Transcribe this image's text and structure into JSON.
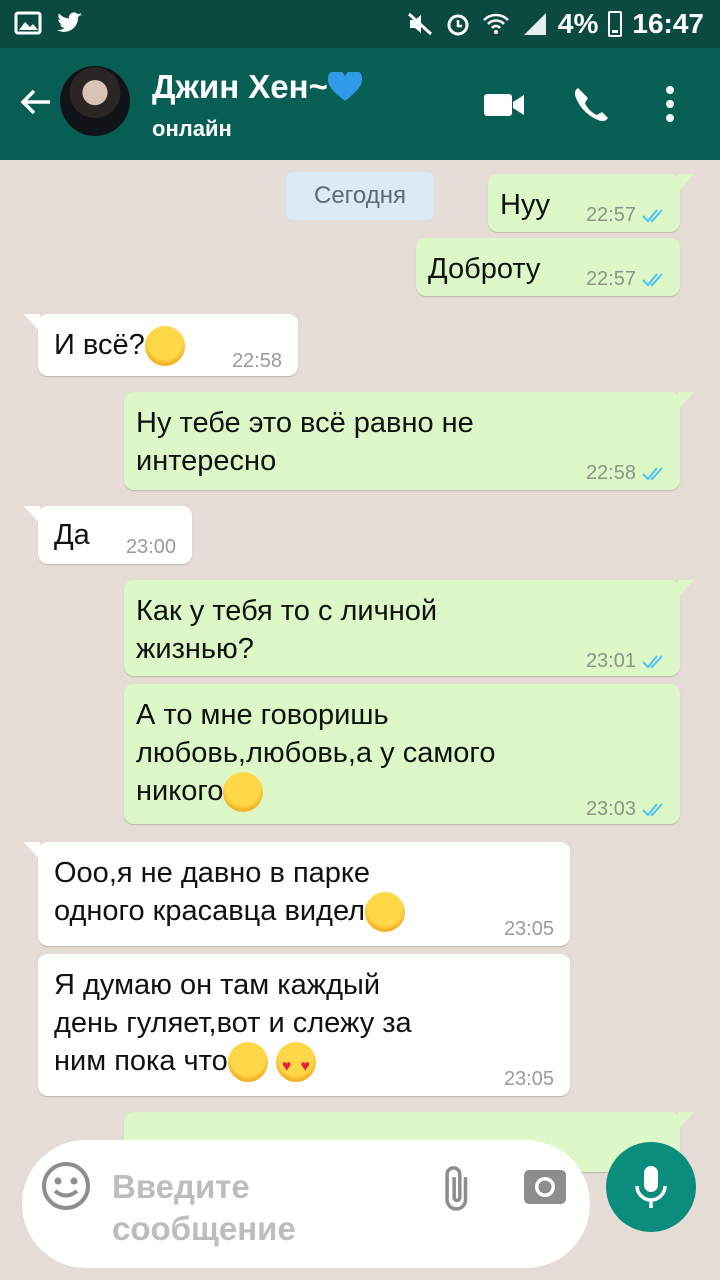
{
  "status_bar": {
    "battery": "4%",
    "time": "16:47"
  },
  "header": {
    "name": "Джин Хен~",
    "status": "онлайн",
    "name_icon": "blue-heart-icon"
  },
  "date_label": "Сегодня",
  "messages": [
    {
      "dir": "out",
      "text": "Нуу",
      "time": "22:57"
    },
    {
      "dir": "out",
      "text": "Доброту",
      "time": "22:57"
    },
    {
      "dir": "in",
      "text": "И всё?",
      "time": "22:58",
      "emoji": "laughing-emoji"
    },
    {
      "dir": "out",
      "text": "Ну тебе это всё равно не\nинтересно",
      "time": "22:58"
    },
    {
      "dir": "in",
      "text": "Да",
      "time": "23:00"
    },
    {
      "dir": "out",
      "text": "Как у тебя то с личной\nжизнью?",
      "time": "23:01"
    },
    {
      "dir": "out",
      "text": "А то мне говоришь\nлюбовь,любовь,а у самого\nникого",
      "time": "23:03",
      "emoji": "smirk-emoji"
    },
    {
      "dir": "in",
      "text": "Ооо,я не давно в парке\nодного красавца видел",
      "time": "23:05",
      "emoji": "drooling-emoji"
    },
    {
      "dir": "in",
      "text": "Я думаю он там каждый\nдень гуляет,вот и слежу за\nним пока что",
      "time": "23:05",
      "emoji": "drooling-emoji heart-eyes-emoji"
    }
  ],
  "input": {
    "placeholder": "Введите\nсообщение"
  },
  "colors": {
    "header": "#075e54",
    "status_bar": "#0b4a40",
    "outgoing": "#dcf8c6",
    "incoming": "#ffffff",
    "read_tick": "#4fc3f7",
    "fab": "#0b8d7e"
  }
}
